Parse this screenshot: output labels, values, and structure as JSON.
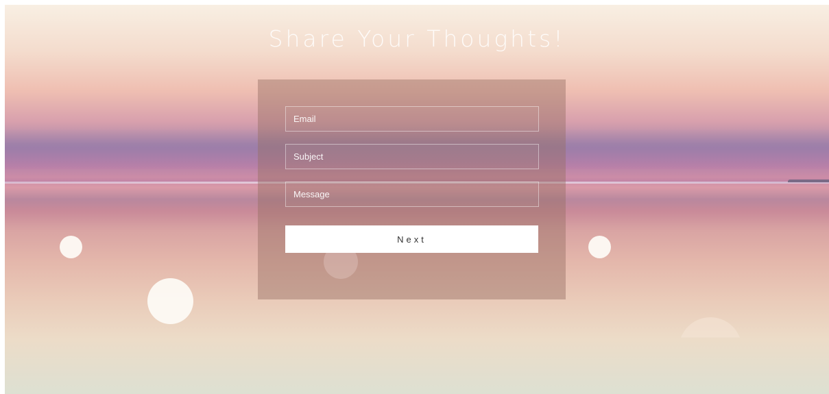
{
  "page": {
    "title": "Share Your Thoughts!"
  },
  "form": {
    "email_placeholder": "Email",
    "subject_placeholder": "Subject",
    "message_placeholder": "Message",
    "next_label": "Next"
  },
  "colors": {
    "panel_overlay": "#966e64",
    "button_bg": "#ffffff",
    "button_text": "#333333",
    "bubble": "#fdfaf4"
  },
  "decorations": {
    "bubbles": [
      "bubble-small-left",
      "bubble-large-left",
      "bubble-small-right",
      "bubble-faint-center",
      "bubble-half-bottom-right"
    ]
  }
}
